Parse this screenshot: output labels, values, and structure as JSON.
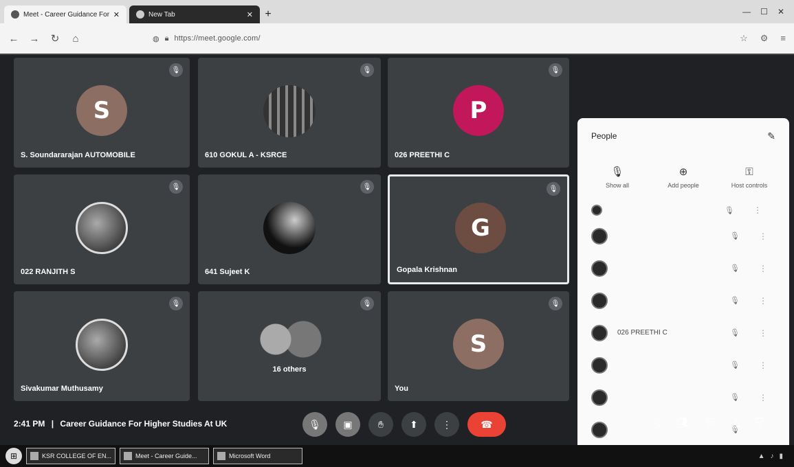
{
  "browser": {
    "tabs": [
      {
        "label": "Meet - Career Guidance For",
        "active": true
      },
      {
        "label": "New Tab",
        "active": false
      }
    ],
    "url": "https://meet.google.com/"
  },
  "tiles": [
    {
      "name": "S. Soundararajan AUTOMOBILE",
      "initial": "S",
      "avatar_color": "#8d6e63",
      "kind": "initial"
    },
    {
      "name": "610 GOKUL A - KSRCE",
      "initial": "",
      "avatar_color": "#555555",
      "kind": "striped"
    },
    {
      "name": "026 PREETHI C",
      "initial": "P",
      "avatar_color": "#c2185b",
      "kind": "initial"
    },
    {
      "name": "022 RANJITH S",
      "initial": "",
      "avatar_color": "#777777",
      "kind": "photo"
    },
    {
      "name": "641 Sujeet K",
      "initial": "",
      "avatar_color": "#333333",
      "kind": "dark"
    },
    {
      "name": "Gopala Krishnan",
      "initial": "G",
      "avatar_color": "#6d4c41",
      "kind": "initial",
      "speaking": true
    },
    {
      "name": "Sivakumar Muthusamy",
      "initial": "",
      "avatar_color": "#999999",
      "kind": "photo"
    },
    {
      "name": "",
      "initial": "",
      "avatar_color": "#555555",
      "kind": "others",
      "others_label": "16 others"
    },
    {
      "name": "You",
      "initial": "S",
      "avatar_color": "#8d6e63",
      "kind": "initial"
    }
  ],
  "panel": {
    "title": "People",
    "actions": [
      {
        "label": "Show all",
        "icon": "mic-off-icon"
      },
      {
        "label": "Add people",
        "icon": "add-person-icon"
      },
      {
        "label": "Host controls",
        "icon": "lock-icon"
      }
    ]
  },
  "meeting": {
    "time": "2:41 PM",
    "separator": "|",
    "title": "Career Guidance For Higher Studies At UK"
  },
  "taskbar": {
    "items": [
      {
        "label": "KSR COLLEGE OF EN..."
      },
      {
        "label": "Meet - Career Guide..."
      },
      {
        "label": "Microsoft Word"
      }
    ]
  }
}
